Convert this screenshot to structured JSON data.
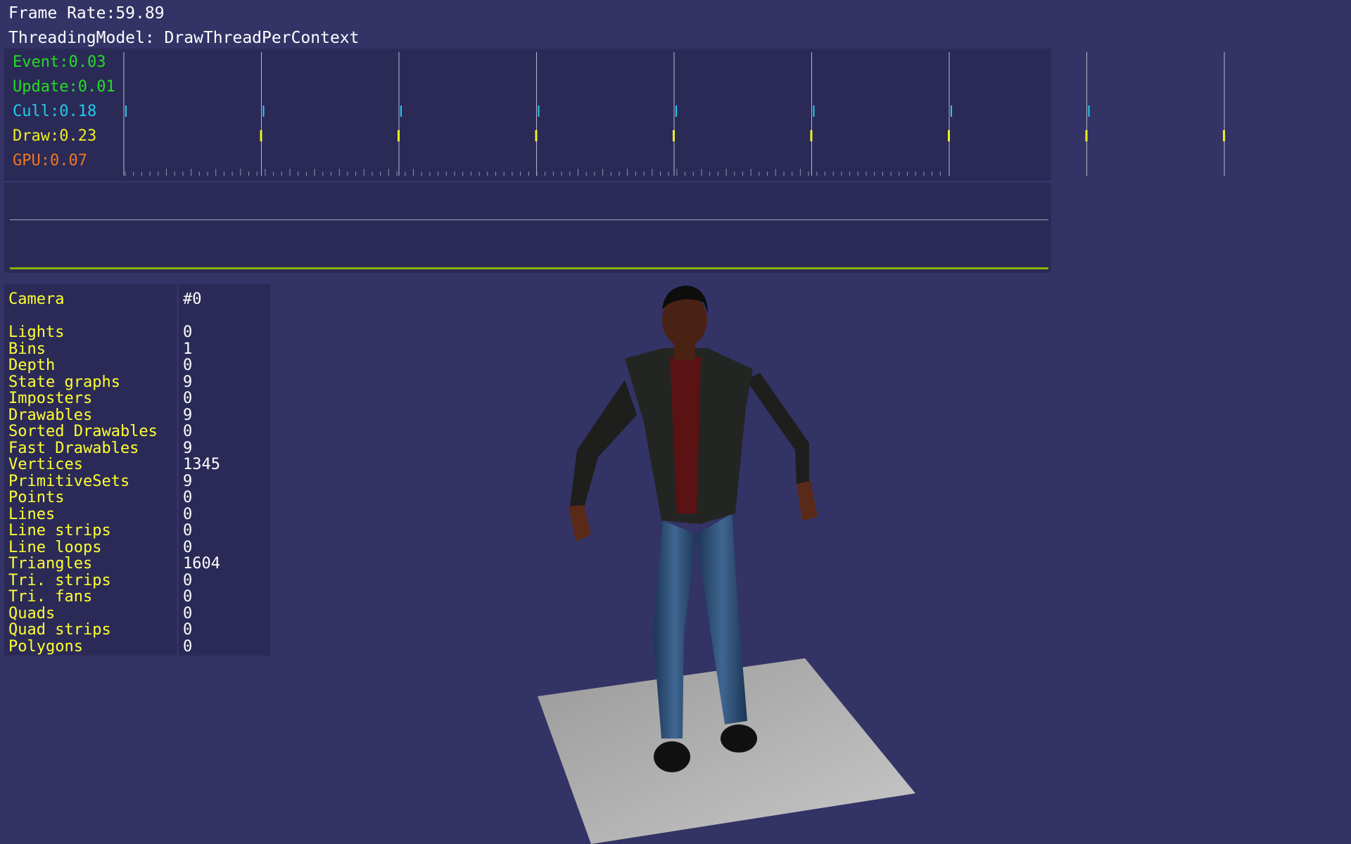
{
  "header": {
    "frame_rate": "Frame Rate:59.89",
    "threading_model": "ThreadingModel: DrawThreadPerContext"
  },
  "stats": [
    {
      "label": "Event:0.03",
      "color": "#22dd22"
    },
    {
      "label": "Update:0.01",
      "color": "#22dd22"
    },
    {
      "label": "Cull:0.18",
      "color": "#22ccee"
    },
    {
      "label": "Draw:0.23",
      "color": "#eeee22"
    },
    {
      "label": "GPU:0.07",
      "color": "#ee7722"
    }
  ],
  "camera": {
    "title_label": "Camera",
    "title_value": "#0",
    "rows": [
      {
        "label": "Lights",
        "value": "0"
      },
      {
        "label": "Bins",
        "value": "1"
      },
      {
        "label": "Depth",
        "value": "0"
      },
      {
        "label": "State graphs",
        "value": "9"
      },
      {
        "label": "Imposters",
        "value": "0"
      },
      {
        "label": "Drawables",
        "value": "9"
      },
      {
        "label": "Sorted Drawables",
        "value": "0"
      },
      {
        "label": "Fast Drawables",
        "value": "9"
      },
      {
        "label": "Vertices",
        "value": "1345"
      },
      {
        "label": "PrimitiveSets",
        "value": "9"
      },
      {
        "label": "Points",
        "value": "0"
      },
      {
        "label": "Lines",
        "value": "0"
      },
      {
        "label": "Line strips",
        "value": "0"
      },
      {
        "label": "Line loops",
        "value": "0"
      },
      {
        "label": "Triangles",
        "value": "1604"
      },
      {
        "label": "Tri. strips",
        "value": "0"
      },
      {
        "label": "Tri. fans",
        "value": "0"
      },
      {
        "label": "Quads",
        "value": "0"
      },
      {
        "label": "Quad strips",
        "value": "0"
      },
      {
        "label": "Polygons",
        "value": "0"
      }
    ]
  },
  "colors": {
    "background": "#333366",
    "panel": "#2b2a57",
    "label_yellow": "#ffff33",
    "graph_green": "#86b300"
  }
}
